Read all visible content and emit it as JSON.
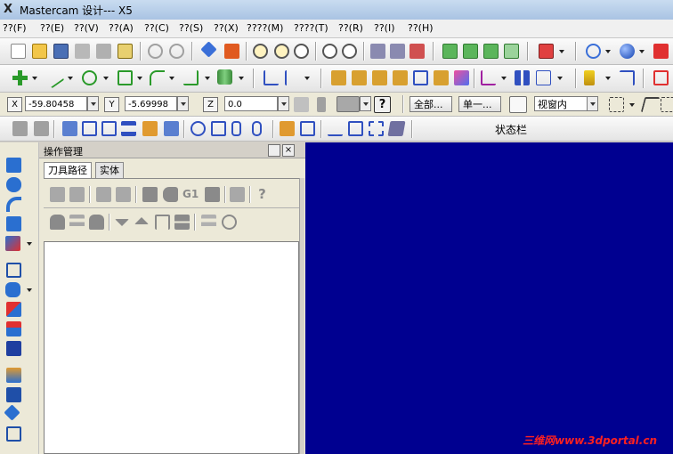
{
  "window": {
    "app_icon": "X",
    "title": "Mastercam 设计--- X5"
  },
  "menu": {
    "items": [
      "??(F)",
      "??(E)",
      "??(V)",
      "??(A)",
      "??(C)",
      "??(S)",
      "??(X)",
      "????(M)",
      "????(T)",
      "??(R)",
      "??(I)",
      "??(H)"
    ]
  },
  "coord_bar": {
    "x_label": "X",
    "x_value": "-59.80458",
    "y_label": "Y",
    "y_value": "-5.69998",
    "z_label": "Z",
    "z_value": "0.0",
    "all_button": "全部...",
    "single_button": "单一...",
    "view_select": "视窗内"
  },
  "status_bar": {
    "label": "状态栏"
  },
  "panel": {
    "title": "操作管理",
    "tabs": [
      "刀具路径",
      "实体"
    ],
    "toolpath_row1_text": "G1"
  },
  "watermark": "三维网www.3dportal.cn",
  "colors": {
    "viewport": "#000090",
    "watermark": "#ff2020"
  }
}
